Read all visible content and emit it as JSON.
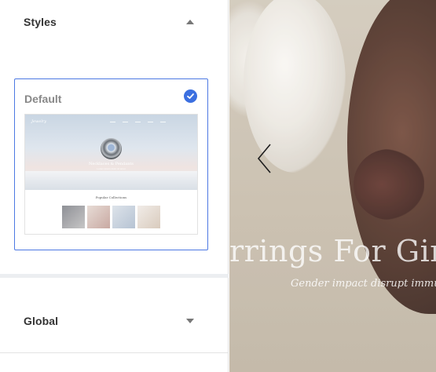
{
  "panel": {
    "styles_section": {
      "title": "Styles",
      "expanded": true,
      "selected_style": {
        "name": "Default",
        "selected": true,
        "thumbnail": {
          "logo": "Jewelry",
          "hero_title": "Necklaces & Pendants",
          "hero_subtitle": "Lorem ipsum dolor sit amet",
          "section_title": "Popular Collections"
        }
      }
    },
    "global_section": {
      "title": "Global",
      "expanded": false
    }
  },
  "preview": {
    "hero_title": "rrings For Girls",
    "hero_subtitle": "Gender impact disrupt immunize"
  },
  "colors": {
    "accent": "#3b6fe0",
    "card_border": "#4d79e3"
  },
  "icons": {
    "styles_toggle": "caret-up-icon",
    "global_toggle": "caret-down-icon",
    "selected_check": "check-circle-icon",
    "slider_prev": "chevron-left-icon"
  }
}
